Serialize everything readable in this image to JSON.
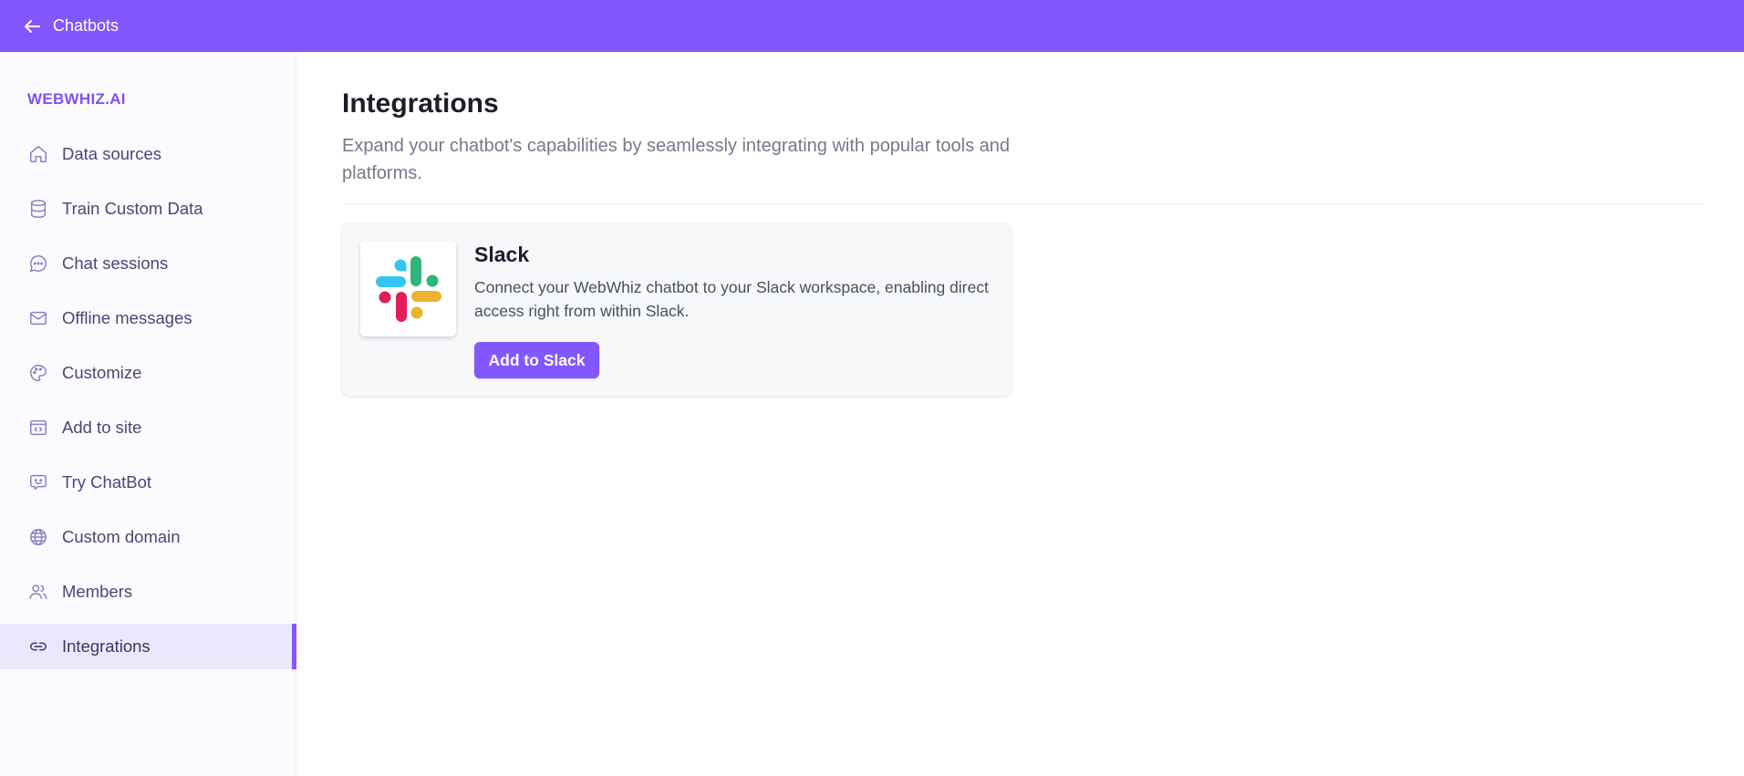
{
  "topbar": {
    "back_label": "Chatbots",
    "back_icon": "arrow-left-icon",
    "color": "#8257fe"
  },
  "sidebar": {
    "brand": "WEBWHIZ.AI",
    "brand_color": "#7d55f0",
    "active_index": 9,
    "items": [
      {
        "label": "Data sources",
        "icon": "home-icon"
      },
      {
        "label": "Train Custom Data",
        "icon": "database-icon"
      },
      {
        "label": "Chat sessions",
        "icon": "chat-bubble-icon"
      },
      {
        "label": "Offline messages",
        "icon": "mail-icon"
      },
      {
        "label": "Customize",
        "icon": "palette-icon"
      },
      {
        "label": "Add to site",
        "icon": "code-window-icon"
      },
      {
        "label": "Try ChatBot",
        "icon": "robot-face-icon"
      },
      {
        "label": "Custom domain",
        "icon": "globe-icon"
      },
      {
        "label": "Members",
        "icon": "users-icon"
      },
      {
        "label": "Integrations",
        "icon": "link-icon"
      }
    ]
  },
  "main": {
    "title": "Integrations",
    "subtitle": "Expand your chatbot's capabilities by seamlessly integrating with popular tools and platforms.",
    "integrations": [
      {
        "name": "Slack",
        "icon": "slack-logo-icon",
        "description": "Connect your WebWhiz chatbot to your Slack workspace, enabling direct access right from within Slack.",
        "button_label": "Add to Slack"
      }
    ]
  }
}
